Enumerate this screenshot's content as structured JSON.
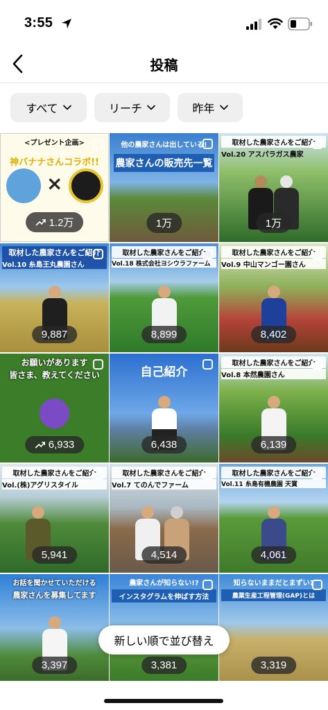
{
  "status_bar": {
    "time": "3:55"
  },
  "nav": {
    "title": "投稿"
  },
  "filters": [
    {
      "label": "すべて"
    },
    {
      "label": "リーチ"
    },
    {
      "label": "昨年"
    }
  ],
  "posts": [
    {
      "banner": "<プレゼント企画>",
      "line2": "神バナナさんコラボ!!",
      "count": "1.2万",
      "trending": true
    },
    {
      "banner": "他の農家さんは出している!",
      "line2": "農家さんの販売先一覧",
      "count": "1万",
      "trending": false
    },
    {
      "banner": "取材した農家さんをご紹介",
      "line2": "Vol.20 アスパラガス農家",
      "count": "1万",
      "trending": false
    },
    {
      "banner": "取材した農家さんをご紹介",
      "line2": "Vol.10 糸島王丸農園さん",
      "count": "9,887",
      "trending": false
    },
    {
      "banner": "取材した農家さんをご紹介",
      "line2": "Vol.18 株式会社ヨシウラファーム",
      "count": "8,899",
      "trending": false
    },
    {
      "banner": "取材した農家さんをご紹介",
      "line2": "Vol.9 中山マンゴー園さん",
      "count": "8,402",
      "trending": false
    },
    {
      "banner": "お願いがあります",
      "line2": "皆さま、教えてください",
      "count": "6,933",
      "trending": true
    },
    {
      "banner": "",
      "line2": "自己紹介",
      "count": "6,438",
      "trending": false
    },
    {
      "banner": "取材した農家さんをご紹介",
      "line2": "Vol.8 本然農園さん",
      "count": "6,139",
      "trending": false
    },
    {
      "banner": "取材した農家さんをご紹介",
      "line2": "Vol.(株)アグリスタイル",
      "count": "5,941",
      "trending": false
    },
    {
      "banner": "取材した農家さんをご紹介",
      "line2": "Vol.7 てのんでファーム",
      "count": "4,514",
      "trending": false
    },
    {
      "banner": "取材した農家さんをご紹介",
      "line2": "Vol.11 糸島有機農園 天賞",
      "count": "4,061",
      "trending": false
    },
    {
      "banner": "お話を聞かせていただける",
      "line2": "農家さんを募集してます",
      "count": "3,397",
      "trending": false
    },
    {
      "banner": "農家さんが知らない!?",
      "line2": "インスタグラムを伸ばす方法",
      "count": "3,381",
      "trending": false
    },
    {
      "banner": "知らないままだとまずい?",
      "line2": "農業生産工程管理(GAP)とは",
      "count": "3,319",
      "trending": false
    }
  ],
  "sort_button": {
    "label": "新しい順で並び替え"
  },
  "colors": {
    "chip_bg": "#efefef",
    "count_pill": "#282828"
  }
}
